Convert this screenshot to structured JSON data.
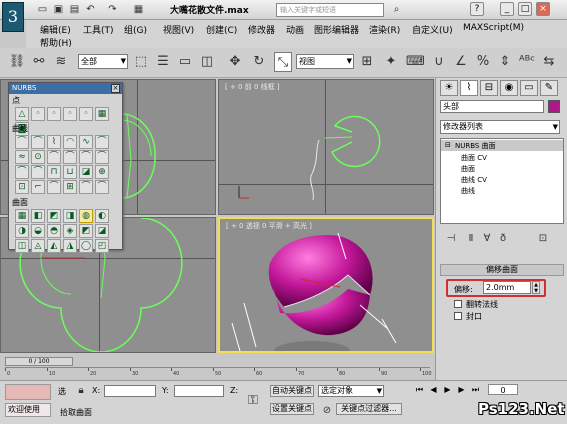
{
  "window": {
    "title": "大嘴花散文件.max",
    "search_placeholder": "输入关键字或短语",
    "logo": "3",
    "quick_access_icons": [
      "new-icon",
      "open-icon",
      "save-icon",
      "undo-icon",
      "redo-icon",
      "project-folder-icon"
    ],
    "controls": [
      "help-icon",
      "minimize-icon",
      "maximize-icon",
      "close-icon"
    ]
  },
  "menu": [
    {
      "label": "编辑(E)"
    },
    {
      "label": "工具(T)"
    },
    {
      "label": "组(G)"
    },
    {
      "label": "视图(V)"
    },
    {
      "label": "创建(C)"
    },
    {
      "label": "修改器"
    },
    {
      "label": "动画"
    },
    {
      "label": "图形编辑器"
    },
    {
      "label": "渲染(R)"
    },
    {
      "label": "自定义(U)"
    },
    {
      "label": "MAXScript(M)"
    },
    {
      "label": "帮助(H)"
    }
  ],
  "toolbar": {
    "selection_filter": "全部",
    "reference_coord": "视图"
  },
  "viewports": {
    "top": {
      "label": ""
    },
    "front": {
      "label": "[ + 0 前 0 线框 ]"
    },
    "left": {
      "label": ""
    },
    "perspective": {
      "label": "[ + 0 透视 0 平滑 + 高光 ]"
    }
  },
  "nurbs_panel": {
    "title": "NURBS",
    "section_point": "点",
    "section_curve": "曲线",
    "section_surface": "曲面",
    "point_icons": [
      "△",
      "◦",
      "◦",
      "◦",
      "◦",
      "▦",
      "◙"
    ],
    "curve_icons": [
      "⌒",
      "⌒",
      "⌇",
      "◠",
      "∿",
      "⌒",
      "≈",
      "⊙",
      "⌒",
      "⌒",
      "⌒",
      "⌒",
      "⌒",
      "⌒",
      "⊓",
      "⊔",
      "◪",
      "⊕",
      "⊡",
      "⌐",
      "⌒",
      "⊞",
      "⌒",
      "⌒"
    ],
    "surface_icons": [
      "▦",
      "◧",
      "◩",
      "◨",
      "◍",
      "◐",
      "◑",
      "◒",
      "◓",
      "◈",
      "◩",
      "◪",
      "◫",
      "◬",
      "◭",
      "◮",
      "◯",
      "◰"
    ]
  },
  "command_panel": {
    "tab_icons": [
      "sun-icon",
      "bend-icon",
      "hierarchy-icon",
      "motion-icon",
      "display-icon",
      "utility-icon"
    ],
    "object_name": "头部",
    "object_color": "#b0178a",
    "modifier_list": "修改器列表",
    "stack": [
      {
        "label": "NURBS 曲面",
        "indent": 0
      },
      {
        "label": "曲面 CV",
        "indent": 1
      },
      {
        "label": "曲面",
        "indent": 1
      },
      {
        "label": "曲线 CV",
        "indent": 1
      },
      {
        "label": "曲线",
        "indent": 1
      }
    ],
    "stack_buttons": [
      "pin-icon",
      "show-end-icon",
      "make-unique-icon",
      "remove-modifier-icon",
      "configure-icon"
    ],
    "rollout_title": "偏移曲面",
    "offset_label": "偏移:",
    "offset_value": "2.0mm",
    "flip_normals_label": "翻转法线",
    "cap_label": "封口"
  },
  "timeline": {
    "frame_display": "0 / 100",
    "ticks": [
      "0",
      "10",
      "20",
      "30",
      "40",
      "50",
      "60",
      "70",
      "80",
      "90",
      "100"
    ]
  },
  "statusbar": {
    "selected_label": "选",
    "x_label": "X:",
    "y_label": "Y:",
    "z_label": "Z:",
    "prompt_text": "拾取曲面",
    "welcome": "欢迎使用",
    "auto_key": "自动关键点",
    "set_key": "设置关键点",
    "key_target": "选定对象",
    "key_filters": "关键点过滤器...",
    "frame_value": "0",
    "playback_icons": [
      "goto-start-icon",
      "prev-frame-icon",
      "play-icon",
      "next-frame-icon",
      "goto-end-icon"
    ]
  },
  "watermark": {
    "logo_text": "Ps123.Net"
  }
}
